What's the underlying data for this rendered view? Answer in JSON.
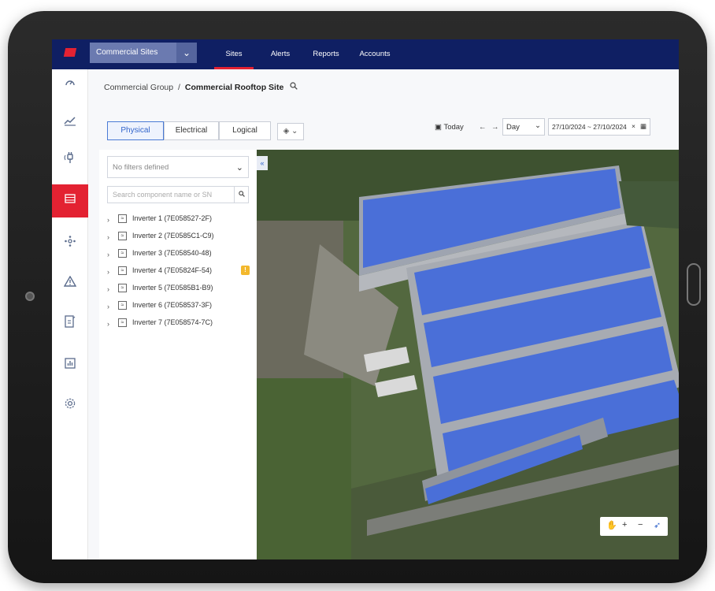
{
  "app": {
    "site_selector": "Commercial Sites",
    "nav": [
      "Sites",
      "Alerts",
      "Reports",
      "Accounts"
    ],
    "active_nav": "Sites"
  },
  "breadcrumb": {
    "group": "Commercial Group",
    "separator": "/",
    "site": "Commercial Rooftop Site"
  },
  "view_tabs": [
    "Physical",
    "Electrical",
    "Logical"
  ],
  "active_tab": "Physical",
  "date_controls": {
    "today_label": "Today",
    "period": "Day",
    "range": "27/10/2024 ~ 27/10/2024"
  },
  "filter": {
    "placeholder": "No filters defined",
    "search_placeholder": "Search component name or SN"
  },
  "inverters": [
    {
      "label": "Inverter 1 (7E058527-2F)",
      "warning": false
    },
    {
      "label": "Inverter 2 (7E0585C1-C9)",
      "warning": false
    },
    {
      "label": "Inverter 3 (7E058540-48)",
      "warning": false
    },
    {
      "label": "Inverter 4 (7E05824F-54)",
      "warning": true
    },
    {
      "label": "Inverter 5 (7E0585B1-B9)",
      "warning": false
    },
    {
      "label": "Inverter 6 (7E058537-3F)",
      "warning": false
    },
    {
      "label": "Inverter 7 (7E058574-7C)",
      "warning": false
    }
  ],
  "colors": {
    "topbar": "#0f1f63",
    "accent": "#e32232",
    "tab_active": "#3366cc",
    "warning": "#f3b82d",
    "panel_roof": "#4a6fd8"
  },
  "icons": {
    "sidebar": [
      "dashboard-icon",
      "chart-icon",
      "plug-icon",
      "layout-icon",
      "devices-icon",
      "alert-icon",
      "report-icon",
      "stats-icon",
      "settings-icon"
    ],
    "map_controls": [
      "pan-icon",
      "zoom-in-icon",
      "zoom-out-icon",
      "compass-icon"
    ]
  }
}
